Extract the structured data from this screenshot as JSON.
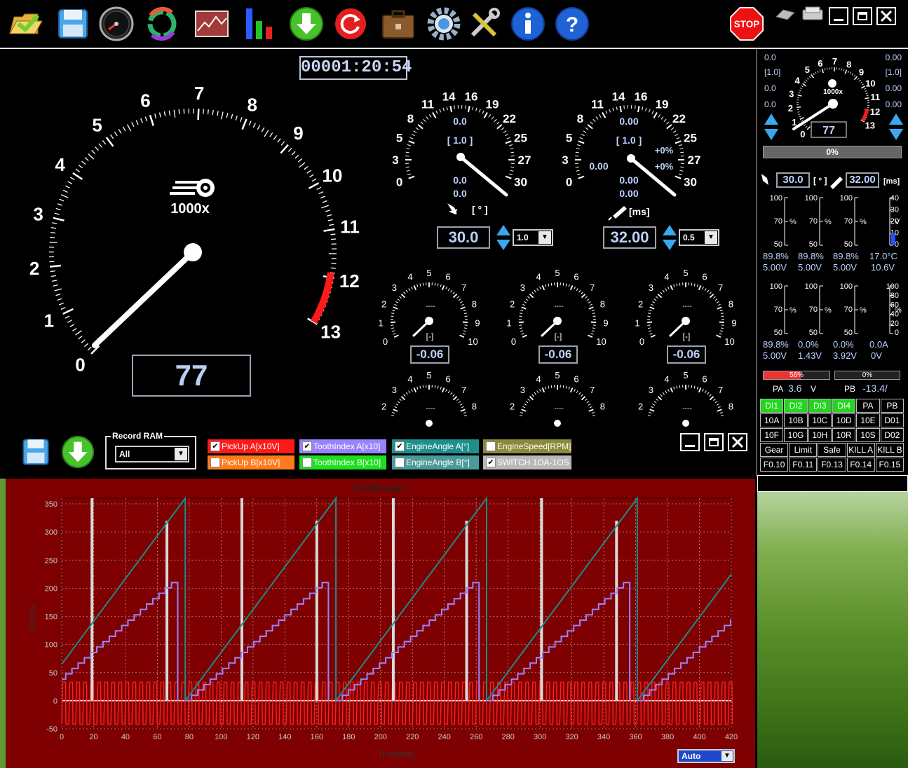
{
  "toolbar": {
    "icons": [
      "open-folder-icon",
      "save-icon",
      "speedometer-icon",
      "sync-icon",
      "line-chart-icon",
      "bar-chart-icon",
      "download-icon",
      "refresh-icon",
      "toolbox-icon",
      "gear-icon",
      "tools-icon",
      "info-icon",
      "help-icon"
    ],
    "stop_label": "STOP"
  },
  "timer": "00001:20:54",
  "main_gauge": {
    "ticks": [
      "0",
      "1",
      "2",
      "3",
      "4",
      "5",
      "6",
      "7",
      "8",
      "9",
      "10",
      "11",
      "12",
      "13"
    ],
    "multiplier": "1000x",
    "rpm_value": "77",
    "needle_value": 0.077
  },
  "advance_gauge": {
    "ticks": [
      "0",
      "3",
      "5",
      "8",
      "11",
      "14",
      "16",
      "19",
      "22",
      "25",
      "27",
      "30"
    ],
    "line1": "0.0",
    "line2": "[ 1.0 ]",
    "line3": "0.0",
    "line4": "0.0",
    "unit": "[ ° ]",
    "value": "30.0",
    "step": "1.0"
  },
  "inject_gauge": {
    "ticks": [
      "0",
      "3",
      "5",
      "8",
      "11",
      "14",
      "16",
      "19",
      "22",
      "25",
      "27",
      "30"
    ],
    "line1": "0.00",
    "line2": "[ 1.0 ]",
    "pct1": "+0%",
    "pct2": "+0%",
    "left": "0.00",
    "line3": "0.00",
    "line4": "0.00",
    "unit": "[ms]",
    "value": "32.00",
    "step": "0.5"
  },
  "small_gauges": {
    "ticks": [
      "0",
      "1",
      "2",
      "3",
      "4",
      "5",
      "6",
      "7",
      "8",
      "9",
      "10"
    ],
    "dashes": "----",
    "unit": "[-]",
    "values": [
      "-0.06",
      "-0.06",
      "-0.06"
    ]
  },
  "record": {
    "title": "Record RAM",
    "selected": "All"
  },
  "channels": [
    {
      "label": "PickUp A[x10V]",
      "checked": true,
      "color": "#ff1a1a",
      "text": "#fff"
    },
    {
      "label": "ToothIndex A[x10]",
      "checked": true,
      "color": "#9a82ff",
      "text": "#fff"
    },
    {
      "label": "EngineAngle A[°]",
      "checked": true,
      "color": "#1f8f8c",
      "text": "#fff"
    },
    {
      "label": "EngineSpeed[RPM]",
      "checked": false,
      "color": "#8a8a3a",
      "text": "#fff"
    },
    {
      "label": "PickUp B[x10V]",
      "checked": false,
      "color": "#ff7a1a",
      "text": "#fff"
    },
    {
      "label": "ToothIndex B[x10]",
      "checked": false,
      "color": "#1fe01f",
      "text": "#fff"
    },
    {
      "label": "EngineAngle B[°]",
      "checked": false,
      "color": "#4a9a9a",
      "text": "#fff"
    },
    {
      "label": "SWITCH 1OA-1OS",
      "checked": true,
      "color": "#b8b8b8",
      "text": "#fff"
    }
  ],
  "oscilloscope": {
    "title": "Oscilloscope",
    "ylabel": "Sample",
    "xlabel": "Time[ms]",
    "auto_label": "Auto"
  },
  "chart_data": {
    "type": "line",
    "title": "Oscilloscope",
    "xlabel": "Time[ms]",
    "ylabel": "Sample",
    "xlim": [
      0,
      420
    ],
    "ylim": [
      -50,
      360
    ],
    "x_ticks": [
      0,
      20,
      40,
      60,
      80,
      100,
      120,
      140,
      160,
      180,
      200,
      220,
      240,
      260,
      280,
      300,
      320,
      340,
      360,
      380,
      400,
      420
    ],
    "y_ticks": [
      -50,
      0,
      50,
      100,
      150,
      200,
      250,
      300,
      350
    ],
    "grid": true,
    "series": [
      {
        "name": "PickUp A[x10V]",
        "color": "#ff2020",
        "period_ms": 4.4,
        "high": 33,
        "low": -42
      },
      {
        "name": "ToothIndex A[x10]",
        "color": "#9a82ff",
        "cycle_ms": 94.5,
        "start_ms": -17,
        "peak": 210,
        "steps": 23
      },
      {
        "name": "EngineAngle A[°]",
        "color": "#1c8c8a",
        "cycle_ms": 94.5,
        "start_ms": -17,
        "peak": 360
      },
      {
        "name": "SWITCH 1OA-1OS",
        "color": "#d8d8d8",
        "pulse_ms": [
          19,
          66,
          113,
          160,
          208,
          254,
          301,
          348,
          395
        ],
        "pulse_heights": [
          360,
          320,
          360,
          320,
          360,
          320,
          360,
          320,
          0
        ]
      }
    ]
  },
  "side": {
    "top_left": [
      "0.0",
      "[1.0]",
      "0.0",
      "0.0"
    ],
    "top_right": [
      "0.00",
      "[1.0]",
      "0.00",
      "0.00"
    ],
    "mini_ticks": [
      "0",
      "1",
      "2",
      "3",
      "4",
      "5",
      "6",
      "7",
      "8",
      "9",
      "10",
      "11",
      "12",
      "13"
    ],
    "mini_mult": "1000x",
    "mini_rpm": "77",
    "progress_label": "0%",
    "adv": "30.0",
    "adv_unit": "[ ° ]",
    "inj": "32.00",
    "inj_unit": "[ms]",
    "bars_row1": {
      "scales": [
        [
          "100",
          "70",
          "50"
        ],
        [
          "100",
          "70",
          "50"
        ],
        [
          "100",
          "70",
          "50"
        ],
        [
          "40",
          "30",
          "20",
          "10",
          "0"
        ]
      ],
      "pct": [
        "89.8%",
        "89.8%",
        "89.8%",
        "17.0°C"
      ],
      "volt": [
        "5.00V",
        "5.00V",
        "5.00V",
        "10.6V"
      ],
      "units": [
        "%",
        "%",
        "%",
        "V"
      ],
      "levels": [
        0.898,
        0.898,
        0.898,
        0.265
      ]
    },
    "bars_row2": {
      "scales": [
        [
          "100",
          "70",
          "50"
        ],
        [
          "100",
          "70",
          "50"
        ],
        [
          "100",
          "70",
          "50"
        ],
        [
          "100",
          "80",
          "60",
          "40",
          "20",
          "0"
        ]
      ],
      "pct": [
        "89.8%",
        "0.0%",
        "0.0%",
        "0.0A"
      ],
      "volt": [
        "5.00V",
        "1.43V",
        "3.92V",
        "0V"
      ],
      "units": [
        "%",
        "%",
        "%",
        "%"
      ]
    },
    "pa_pct": "56%",
    "pb_pct": "0%",
    "pa_fill": 0.56,
    "pa_label": "PA",
    "pa_val": "3.6",
    "pa_unit": "V",
    "pb_label": "PB",
    "pb_val": "-13.4/",
    "grid_rows": [
      [
        "DI1",
        "DI2",
        "DI3",
        "DI4",
        "PA",
        "PB"
      ],
      [
        "10A",
        "10B",
        "10C",
        "10D",
        "10E",
        "D01"
      ],
      [
        "10F",
        "10G",
        "10H",
        "10R",
        "10S",
        "D02"
      ],
      [
        "Gear",
        "Limit",
        "Safe",
        "KILL A",
        "KILL B"
      ],
      [
        "F0.10",
        "F0.11",
        "F0.13",
        "F0.14",
        "F0.15"
      ]
    ]
  }
}
